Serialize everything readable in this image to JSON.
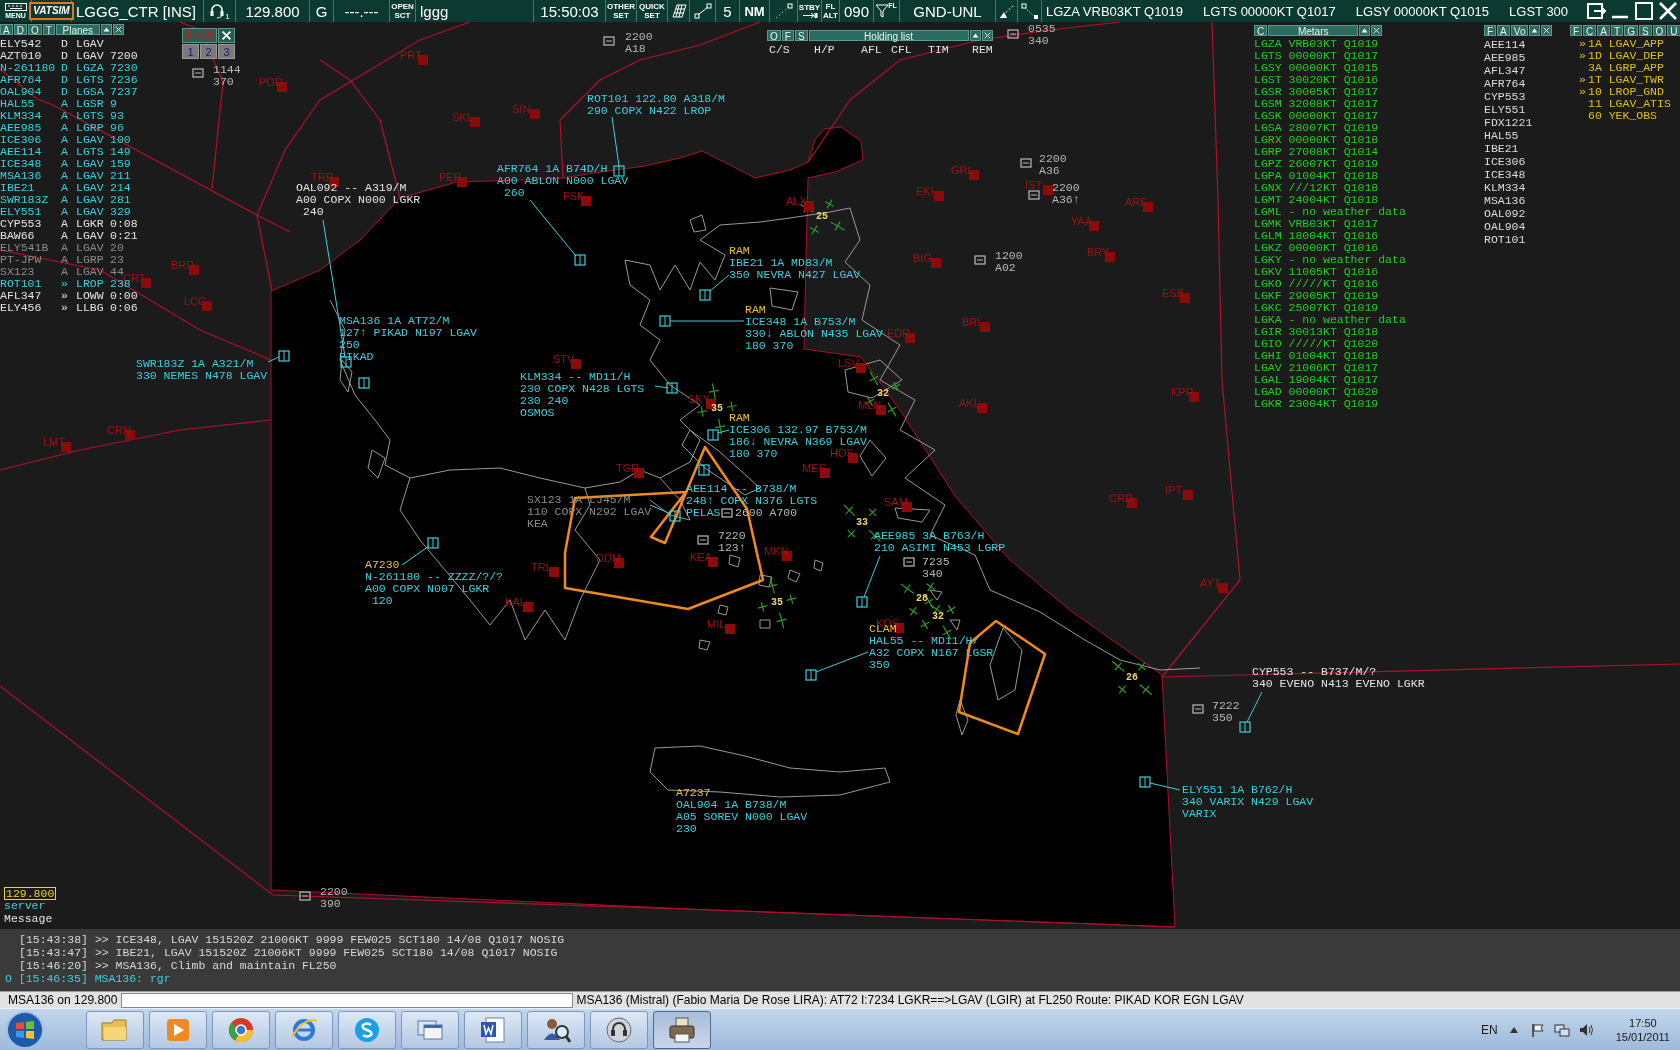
{
  "toolbar": {
    "menu_label": "MENU",
    "logo": "VATSIM",
    "callsign": "LGGG_CTR [INS]",
    "voice_count": "1",
    "frequency": "129.800",
    "atis_letter": "G",
    "standby_frequency": "---.---",
    "open_button": [
      "OPEN",
      "SCT"
    ],
    "sector": "lggg",
    "clock": "15:50:03",
    "other_set": [
      "OTHER",
      "SET"
    ],
    "quick_set": [
      "QUICK",
      "SET"
    ],
    "range": "5",
    "unit": "NM",
    "standby": "STBY",
    "fl_alt": [
      "FL",
      "ALT"
    ],
    "transition_level": "090",
    "filter_label": "FL",
    "altitude_filter": "GND-UNL",
    "metars": [
      "LGZA VRB03KT Q1019",
      "LGTS 00000KT Q1017",
      "LGSY 00000KT Q1015",
      "LGST 300"
    ]
  },
  "planes_list": {
    "tabs": [
      "A",
      "D",
      "O",
      "T"
    ],
    "title": "Planes",
    "rows": [
      {
        "callsign": "ELY542",
        "flag": "D",
        "airport": "LGAV",
        "assumed": false,
        "inactive": false
      },
      {
        "callsign": "AZT010",
        "flag": "D",
        "airport": "LGAV",
        "value": "7200",
        "assumed": false,
        "inactive": false
      },
      {
        "callsign": "N-261180",
        "flag": "D",
        "airport": "LGZA",
        "value": "7230",
        "assumed": true,
        "inactive": false
      },
      {
        "callsign": "AFR764",
        "flag": "D",
        "airport": "LGTS",
        "value": "7236",
        "assumed": true,
        "inactive": false
      },
      {
        "callsign": "OAL904",
        "flag": "D",
        "airport": "LGSA",
        "value": "7237",
        "assumed": true,
        "inactive": false
      },
      {
        "callsign": "HAL55",
        "flag": "A",
        "airport": "LGSR",
        "value": "9",
        "assumed": true,
        "inactive": false
      },
      {
        "callsign": "KLM334",
        "flag": "A",
        "airport": "LGTS",
        "value": "93",
        "assumed": true,
        "inactive": false
      },
      {
        "callsign": "AEE985",
        "flag": "A",
        "airport": "LGRP",
        "value": "96",
        "assumed": true,
        "inactive": false
      },
      {
        "callsign": "ICE306",
        "flag": "A",
        "airport": "LGAV",
        "value": "100",
        "assumed": true,
        "inactive": false
      },
      {
        "callsign": "AEE114",
        "flag": "A",
        "airport": "LGTS",
        "value": "149",
        "assumed": true,
        "inactive": false
      },
      {
        "callsign": "ICE348",
        "flag": "A",
        "airport": "LGAV",
        "value": "159",
        "assumed": true,
        "inactive": false
      },
      {
        "callsign": "MSA136",
        "flag": "A",
        "airport": "LGAV",
        "value": "211",
        "assumed": true,
        "inactive": false
      },
      {
        "callsign": "IBE21",
        "flag": "A",
        "airport": "LGAV",
        "value": "214",
        "assumed": true,
        "inactive": false
      },
      {
        "callsign": "SWR183Z",
        "flag": "A",
        "airport": "LGAV",
        "value": "281",
        "assumed": true,
        "inactive": false
      },
      {
        "callsign": "ELY551",
        "flag": "A",
        "airport": "LGAV",
        "value": "329",
        "assumed": true,
        "inactive": false
      },
      {
        "callsign": "CYP553",
        "flag": "A",
        "airport": "LGKR",
        "value": "0:08",
        "assumed": false,
        "inactive": false
      },
      {
        "callsign": "BAW66",
        "flag": "A",
        "airport": "LGAV",
        "value": "0:21",
        "assumed": false,
        "inactive": false
      },
      {
        "callsign": "ELY541B",
        "flag": "A",
        "airport": "LGAV",
        "value": "20",
        "assumed": false,
        "inactive": true
      },
      {
        "callsign": "PT-JPW",
        "flag": "A",
        "airport": "LGRP",
        "value": "23",
        "assumed": false,
        "inactive": true
      },
      {
        "callsign": "SX123",
        "flag": "A",
        "airport": "LGAV",
        "value": "44",
        "assumed": false,
        "inactive": true
      },
      {
        "callsign": "ROT101",
        "flag": "»",
        "airport": "LROP",
        "value": "238",
        "assumed": true,
        "inactive": false
      },
      {
        "callsign": "AFL347",
        "flag": "»",
        "airport": "LOWW",
        "value": "0:00",
        "assumed": false,
        "inactive": false
      },
      {
        "callsign": "ELY456",
        "flag": "»",
        "airport": "LLBG",
        "value": "0:06",
        "assumed": false,
        "inactive": false
      }
    ]
  },
  "timer": {
    "time": "0:00",
    "presets": [
      "1",
      "2",
      "3"
    ]
  },
  "holding_list": {
    "tabs": [
      "O",
      "F",
      "S"
    ],
    "title": "Holding list",
    "columns": [
      "C/S",
      "H/P",
      "AFL",
      "CFL",
      "TIM",
      "REM"
    ]
  },
  "metars_list": {
    "tab": "C",
    "title": "Metars",
    "rows": [
      "LGZA VRB03KT Q1019",
      "LGTS 00000KT Q1017",
      "LGSY 00000KT Q1015",
      "LGST 30020KT Q1016",
      "LGSR 30005KT Q1017",
      "LGSM 32008KT Q1017",
      "LGSK 00000KT Q1017",
      "LGSA 28007KT Q1019",
      "LGRX 00000KT Q1018",
      "LGRP 27008KT Q1014",
      "LGPZ 26007KT Q1019",
      "LGPA 01004KT Q1018",
      "LGNX ///12KT Q1018",
      "LGMT 24004KT Q1018",
      "LGML - no weather data",
      "LGMK VRB03KT Q1017",
      "LGLM 18004KT Q1016",
      "LGKZ 00000KT Q1016",
      "LGKY - no weather data",
      "LGKV 11005KT Q1016",
      "LGKO /////KT Q1016",
      "LGKF 29005KT Q1019",
      "LGKC 25007KT Q1019",
      "LGKA - no weather data",
      "LGIR 30013KT Q1018",
      "LGIO /////KT Q1020",
      "LGHI 01004KT Q1018",
      "LGAV 21006KT Q1017",
      "LGAL 19004KT Q1017",
      "LGAD 00000KT Q1020",
      "LGKR 23004KT Q1019"
    ]
  },
  "aircraft_list": {
    "tabs": [
      "F",
      "A",
      "Vo"
    ],
    "rows": [
      "AEE114",
      "AEE985",
      "AFL347",
      "AFR764",
      "CYP553",
      "ELY551",
      "FDX1221",
      "HAL55",
      "IBE21",
      "ICE306",
      "ICE348",
      "KLM334",
      "MSA136",
      "OAL092",
      "OAL904",
      "ROT101"
    ]
  },
  "controller_list": {
    "tabs": [
      "F",
      "C",
      "A",
      "T",
      "G",
      "S",
      "O",
      "U"
    ],
    "rows": [
      {
        "marker": "»",
        "text": "1A LGAV_APP"
      },
      {
        "marker": "»",
        "text": "1D LGAV_DEP"
      },
      {
        "text": "3A LGRP_APP"
      },
      {
        "marker": "»",
        "text": "1T LGAV_TWR"
      },
      {
        "marker": "»",
        "text": "10 LROP_GND"
      },
      {
        "text": "11 LGAV_ATIS"
      },
      {
        "text": "60 YEK_OBS"
      }
    ]
  },
  "navaids": [
    "PRT",
    "SKL",
    "SIN",
    "PEP",
    "FSK",
    "ALX",
    "GRL",
    "EKI",
    "IST",
    "BIG",
    "BRL",
    "EDR",
    "LSV",
    "MLN",
    "AKL",
    "SKY",
    "STV",
    "MES",
    "HOS",
    "TRL",
    "DDM",
    "KEA",
    "MKN",
    "KAL",
    "MIL",
    "KOS",
    "SAM",
    "TGR",
    "POD",
    "BRD",
    "CRT",
    "LCC",
    "TRP",
    "CRN",
    "LMT",
    "ARE",
    "YAA",
    "BRY",
    "ESB",
    "KPR",
    "CRD",
    "IPT",
    "AYT"
  ],
  "runways": [
    "25",
    "32",
    "35",
    "33",
    "28",
    "32",
    "35",
    "26"
  ],
  "aircraft": [
    {
      "lines": [
        "ROT101 122.80 A318/M",
        "290 COPX N422 LROP"
      ],
      "assumed": true,
      "inactive": false
    },
    {
      "lines": [
        "AFR764 1A B74D/H",
        "A00 ABLON N000 LGAV",
        " 260"
      ],
      "assumed": true,
      "inactive": false
    },
    {
      "lines": [
        "OAL092 -- A319/M",
        "A00 COPX N000 LGKR",
        " 240"
      ],
      "assumed": false,
      "inactive": false
    },
    {
      "lines": [
        "MSA136 1A AT72/M",
        "127↑ PIKAD N197 LGAV",
        "250",
        "PIKAD"
      ],
      "assumed": true,
      "inactive": false
    },
    {
      "lines": [
        "SWR183Z 1A A321/M",
        "330 NEMES N478 LGAV"
      ],
      "assumed": true,
      "inactive": false
    },
    {
      "alert": "RAM",
      "lines": [
        "IBE21 1A MD83/M",
        "350 NEVRA N427 LGAV"
      ],
      "assumed": true,
      "inactive": false
    },
    {
      "alert": "RAM",
      "lines": [
        "ICE348 1A B753/M",
        "330↓ ABLON N435 LGAV",
        "180 370"
      ],
      "assumed": true,
      "inactive": false
    },
    {
      "lines": [
        "KLM334 -- MD11/H",
        "230 COPX N428 LGTS",
        "230 240",
        "OSMOS"
      ],
      "assumed": true,
      "inactive": false
    },
    {
      "alert": "RAM",
      "lines": [
        "ICE306 132.97 B753/M",
        "186↓ NEVRA N369 LGAV",
        "180 370"
      ],
      "assumed": true,
      "inactive": false
    },
    {
      "lines": [
        "AEE114 -- B738/M",
        "248↑ COPX N376 LGTS",
        "PELAS"
      ],
      "assumed": true,
      "inactive": false
    },
    {
      "lines": [
        "SX123 1A LJ45/M",
        "110 COPX N292 LGAV",
        "KEA"
      ],
      "assumed": false,
      "inactive": true
    },
    {
      "alert": "A7230",
      "lines": [
        "N-261180 -- ZZZZ/?/?",
        "A00 COPX N007 LGKR",
        " 120"
      ],
      "assumed": true,
      "inactive": false
    },
    {
      "lines": [
        "AEE985 3A B763/H",
        "210 ASIMI N453 LGRP"
      ],
      "assumed": true,
      "inactive": false
    },
    {
      "alert": "CLAM",
      "lines": [
        "HAL55 -- MD11/H/",
        "A32 COPX N167 LGSR",
        "350"
      ],
      "assumed": true,
      "inactive": false
    },
    {
      "lines": [
        "CYP553 -- B737/M/?",
        "340 EVENO N413 EVENO LGKR"
      ],
      "assumed": false,
      "inactive": false
    },
    {
      "alert": "A7237",
      "lines": [
        "OAL904 1A B738/M",
        "A05 SOREV N000 LGAV",
        "230"
      ],
      "assumed": true,
      "inactive": false
    },
    {
      "lines": [
        "ELY551 1A B762/H",
        "340 VARIX N429 LGAV",
        "VARIX"
      ],
      "assumed": true,
      "inactive": false
    }
  ],
  "uncorrelated": [
    {
      "lines": [
        "2200",
        "A18"
      ]
    },
    {
      "lines": [
        "1144",
        "370"
      ]
    },
    {
      "lines": [
        "0535",
        "340"
      ]
    },
    {
      "lines": [
        "2200",
        "A36"
      ]
    },
    {
      "lines": [
        "2200",
        "A36↑"
      ]
    },
    {
      "lines": [
        "1200",
        "A02"
      ]
    },
    {
      "lines": [
        "7220",
        "123↑"
      ]
    },
    {
      "lines": [
        "7235",
        "340"
      ]
    },
    {
      "lines": [
        "7222",
        "350"
      ]
    },
    {
      "lines": [
        "2200",
        "390"
      ]
    },
    {
      "lines": [
        "2600 A700"
      ]
    }
  ],
  "frequency_box": {
    "frequency": "129.800",
    "source": "server",
    "label": "Message"
  },
  "messages": [
    {
      "own": false,
      "text": "[15:43:38] >> ICE348, LGAV 151520Z 21006KT 9999 FEW025 SCT180 14/08 Q1017 NOSIG"
    },
    {
      "own": false,
      "text": "[15:43:47] >> IBE21, LGAV 151520Z 21006KT 9999 FEW025 SCT180 14/08 Q1017 NOSIG"
    },
    {
      "own": false,
      "text": "[15:46:20] >> MSA136, Climb and maintain FL250"
    },
    {
      "own": true,
      "text": "O [15:46:35] MSA136: rgr"
    }
  ],
  "command": {
    "prompt": "MSA136 on 129.800",
    "flight_plan": "MSA136 (Mistral) (Fabio Maria De Rose LIRA): AT72 I:7234 LGKR==>LGAV (LGIR) at FL250 Route: PIKAD KOR EGN LGAV"
  },
  "taskbar": {
    "apps": [
      {
        "kind": "folder",
        "selected": false
      },
      {
        "kind": "player",
        "selected": false
      },
      {
        "kind": "wheel",
        "selected": false
      },
      {
        "kind": "ring",
        "selected": false
      },
      {
        "kind": "chat",
        "selected": false
      },
      {
        "kind": "windows",
        "selected": false
      },
      {
        "kind": "document",
        "selected": false
      },
      {
        "kind": "search",
        "selected": false
      },
      {
        "kind": "speaker",
        "selected": false
      },
      {
        "kind": "printer",
        "selected": true
      }
    ],
    "language": "EN",
    "time": "17:50",
    "date": "15/01/2011"
  }
}
